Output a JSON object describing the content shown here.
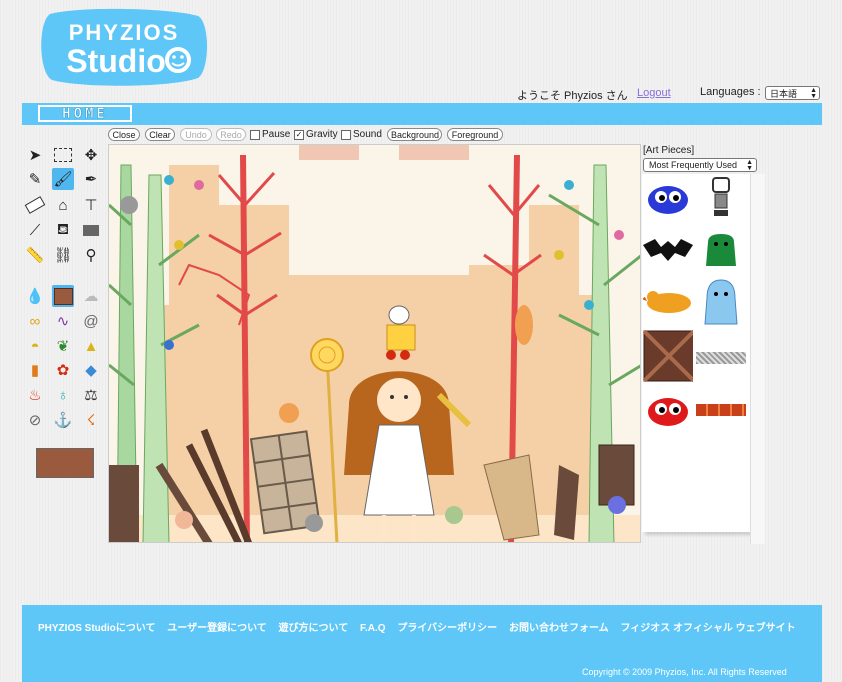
{
  "brand": {
    "logo_line1": "PHYZIOS",
    "logo_line2": "Studio"
  },
  "header": {
    "welcome": "ようこそ Phyzios さん",
    "logout": "Logout",
    "languages_label": "Languages :",
    "language_selected": "日本語"
  },
  "nav": {
    "home": "HOME"
  },
  "toolbar": {
    "close": "Close",
    "clear": "Clear",
    "undo": "Undo",
    "redo": "Redo",
    "pause": "Pause",
    "pause_checked": false,
    "gravity": "Gravity",
    "gravity_checked": true,
    "sound": "Sound",
    "sound_checked": false,
    "background": "Background",
    "foreground": "Foreground"
  },
  "tools": {
    "selected": "brush",
    "current_color": "#9a5a3e"
  },
  "art_panel": {
    "label": "[Art Pieces]",
    "sort_selected": "Most Frequently Used",
    "items": [
      "blue-blob",
      "robot",
      "bat",
      "green-creature",
      "duck",
      "ghost",
      "wooden-crate",
      "gray-texture",
      "red-blob",
      "brick-strip"
    ]
  },
  "footer": {
    "links": [
      "PHYZIOS Studioについて",
      "ユーザー登録について",
      "遊び方について",
      "F.A.Q",
      "プライバシーポリシー",
      "お問い合わせフォーム",
      "フィジオス オフィシャル ウェブサイト"
    ],
    "copyright": "Copyright © 2009 Phyzios, Inc. All Rights Reserved"
  }
}
